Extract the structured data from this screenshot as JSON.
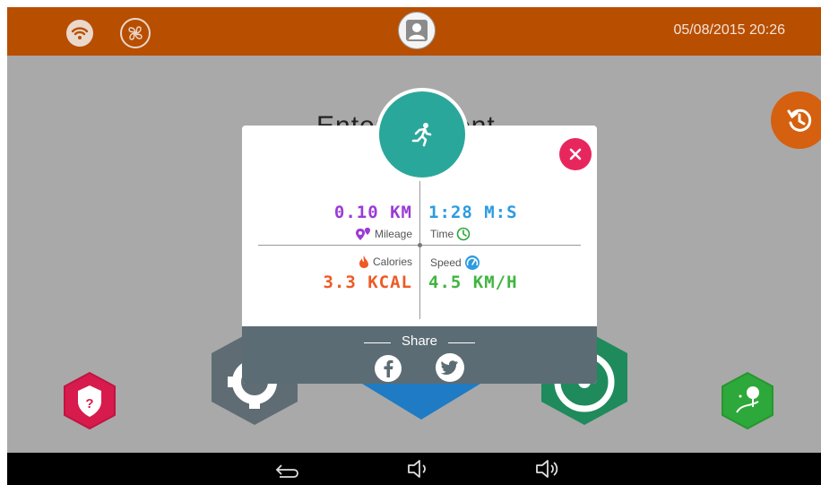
{
  "status_bar": {
    "datetime": "05/08/2015 20:26"
  },
  "background": {
    "title": "Entertainment"
  },
  "stats": {
    "mileage_value": "0.10 KM",
    "mileage_label": "Mileage",
    "time_value": "1:28 M:S",
    "time_label": "Time",
    "calories_value": "3.3 KCAL",
    "calories_label": "Calories",
    "speed_value": "4.5 KM/H",
    "speed_label": "Speed"
  },
  "share": {
    "title": "Share"
  },
  "colors": {
    "topbar": "#b84e00",
    "accent_teal": "#2aa79b",
    "close_pink": "#e8265e",
    "mileage": "#9b3bd6",
    "time": "#2c9be0",
    "calories": "#ee5a24",
    "speed": "#3fb53f"
  },
  "icons": [
    "wifi-icon",
    "fan-icon",
    "user-avatar-icon",
    "history-icon",
    "running-man-icon",
    "close-icon",
    "location-pins-icon",
    "clock-icon",
    "flame-icon",
    "speedometer-icon",
    "facebook-icon",
    "twitter-icon",
    "help-shield-icon",
    "settings-gear-icon",
    "steering-wheel-icon",
    "landscape-icon",
    "back-icon",
    "volume-down-icon",
    "volume-up-icon"
  ]
}
